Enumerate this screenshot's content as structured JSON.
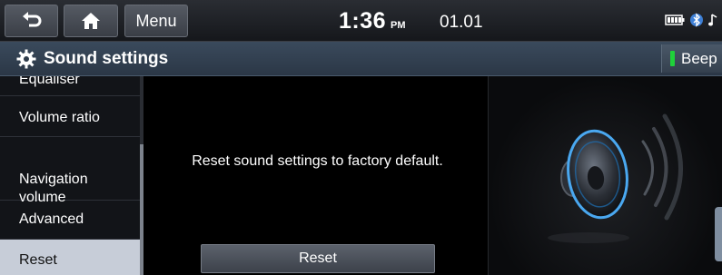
{
  "topbar": {
    "back_icon": "back-arrow-icon",
    "home_icon": "home-icon",
    "menu_label": "Menu",
    "time": "1:36",
    "ampm": "PM",
    "date": "01.01",
    "status_icons": [
      "battery-icon",
      "bluetooth-icon",
      "music-note-icon"
    ]
  },
  "titlebar": {
    "icon": "gear-icon",
    "title": "Sound settings",
    "beep_label": "Beep",
    "beep_indicator_color": "#1fd13a"
  },
  "sidebar": {
    "items": [
      {
        "label": "Equaliser",
        "selected": false
      },
      {
        "label": "Volume ratio",
        "selected": false
      },
      {
        "label": "Navigation\nvolume",
        "selected": false
      },
      {
        "label": "Advanced",
        "selected": false
      },
      {
        "label": "Reset",
        "selected": true
      }
    ]
  },
  "main": {
    "message": "Reset sound settings to factory default.",
    "reset_button_label": "Reset"
  },
  "illustration": {
    "icon": "speaker-icon",
    "accent_color": "#4aa8f0"
  }
}
